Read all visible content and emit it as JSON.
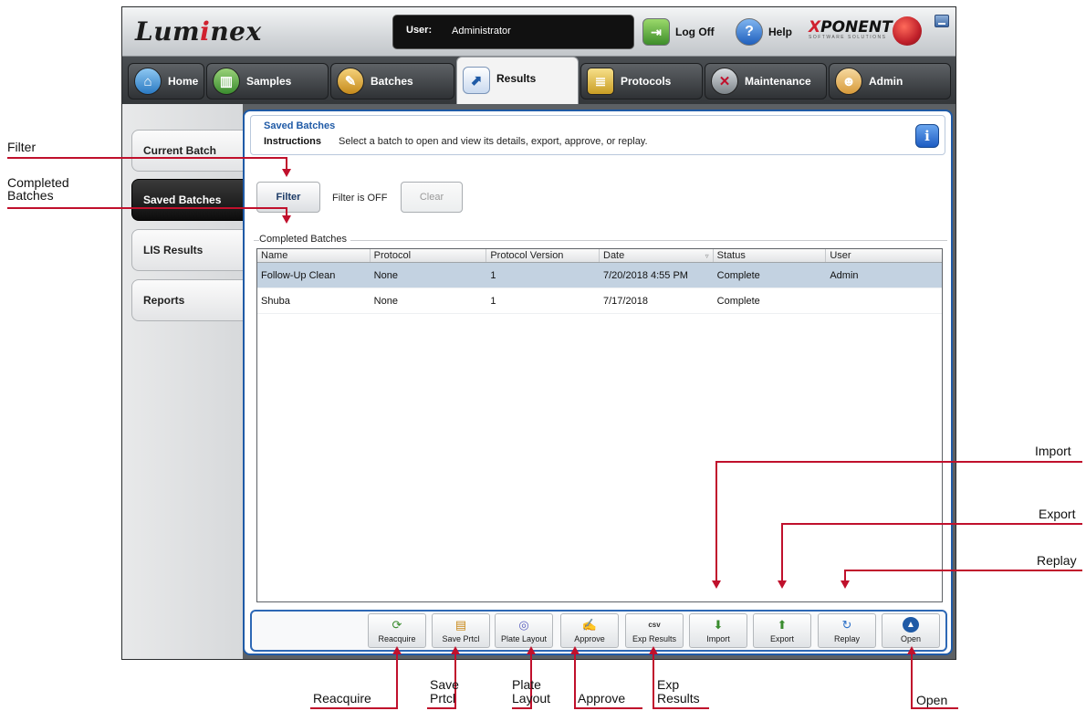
{
  "app": {
    "logo": "Luminex",
    "user_label": "User:",
    "user_name": "Administrator",
    "logoff_label": "Log Off",
    "help_label": "Help",
    "xponent_name": "XPONENT",
    "xponent_sub": "SOFTWARE SOLUTIONS"
  },
  "nav": {
    "tabs": [
      {
        "label": "Home"
      },
      {
        "label": "Samples"
      },
      {
        "label": "Batches"
      },
      {
        "label": "Results",
        "active": true
      },
      {
        "label": "Protocols"
      },
      {
        "label": "Maintenance"
      },
      {
        "label": "Admin"
      }
    ]
  },
  "left": {
    "tabs": [
      {
        "label": "Current Batch"
      },
      {
        "label": "Saved Batches",
        "active": true
      },
      {
        "label": "LIS Results"
      },
      {
        "label": "Reports"
      }
    ]
  },
  "main": {
    "title": "Saved Batches",
    "instructions_label": "Instructions",
    "instructions_text": "Select a batch to open and view its details, export, approve, or replay.",
    "info_icon": "i",
    "filter_label": "Filter",
    "filter_status": "Filter is OFF",
    "clear_label": "Clear",
    "group_label": "Completed Batches"
  },
  "table": {
    "columns": [
      "Name",
      "Protocol",
      "Protocol Version",
      "Date",
      "Status",
      "User"
    ],
    "rows": [
      [
        "Follow-Up Clean",
        "None",
        "1",
        "7/20/2018 4:55 PM",
        "Complete",
        "Admin"
      ],
      [
        "Shuba",
        "None",
        "1",
        "7/17/2018",
        "Complete",
        ""
      ]
    ]
  },
  "toolbar": {
    "buttons": [
      "Reacquire",
      "Save Prtcl",
      "Plate Layout",
      "Approve",
      "Exp Results",
      "Import",
      "Export",
      "Replay",
      "Open"
    ],
    "export_icon_text": "csv"
  },
  "callouts": {
    "filter": "Filter",
    "completed_1": "Completed",
    "completed_2": "Batches",
    "import": "Import",
    "export": "Export",
    "replay": "Replay",
    "reacquire": "Reacquire",
    "save_1": "Save",
    "save_2": "Prtcl",
    "plate_1": "Plate",
    "plate_2": "Layout",
    "approve": "Approve",
    "exp_1": "Exp",
    "exp_2": "Results",
    "open": "Open"
  },
  "colors": {
    "accent_blue": "#1f5aa6",
    "callout_red": "#c0102c",
    "selected_row": "#c3d2e1"
  }
}
